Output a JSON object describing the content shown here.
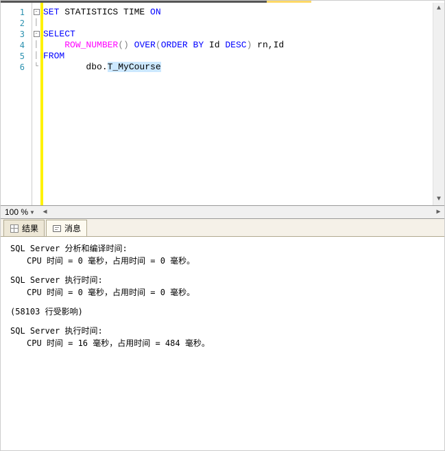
{
  "code": {
    "lines": [
      1,
      2,
      3,
      4,
      5,
      6
    ],
    "l1_set": "SET",
    "l1_stats": " STATISTICS TIME ",
    "l1_on": "ON",
    "l3_select": "SELECT",
    "l4_fn": "ROW_NUMBER",
    "l4_paren": "()",
    "l4_over": "OVER",
    "l4_open": "(",
    "l4_order": "ORDER",
    "l4_by": "BY",
    "l4_col": " Id ",
    "l4_desc": "DESC",
    "l4_close": ")",
    "l4_tail": " rn,Id",
    "l5_from": "FROM",
    "l6_pre": "        dbo.",
    "l6_tbl": "T_MyCourse"
  },
  "zoom": "100 %",
  "tabs": {
    "results": "结果",
    "messages": "消息"
  },
  "msg": {
    "parse_header": "SQL Server 分析和编译时间:",
    "parse_line": "CPU 时间 = 0 毫秒，占用时间 = 0 毫秒。",
    "exec1_header": "SQL Server 执行时间:",
    "exec1_line": "CPU 时间 = 0 毫秒，占用时间 = 0 毫秒。",
    "rows": "(58103 行受影响)",
    "exec2_header": "SQL Server 执行时间:",
    "exec2_line": "CPU 时间 = 16 毫秒，占用时间 = 484 毫秒。"
  }
}
